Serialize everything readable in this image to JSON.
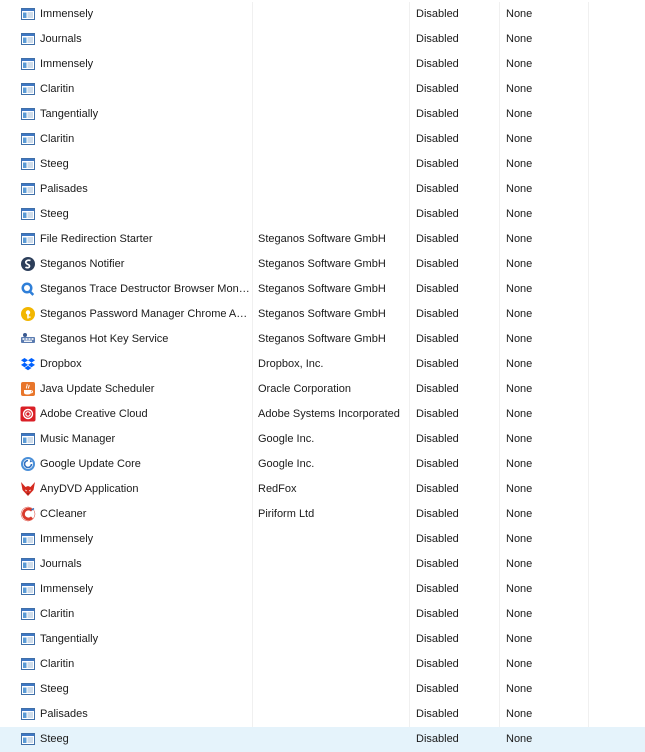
{
  "rows": [
    {
      "icon": "window-icon",
      "name": "Immensely",
      "publisher": "",
      "status": "Disabled",
      "impact": "None"
    },
    {
      "icon": "window-icon",
      "name": "Journals",
      "publisher": "",
      "status": "Disabled",
      "impact": "None"
    },
    {
      "icon": "window-icon",
      "name": "Immensely",
      "publisher": "",
      "status": "Disabled",
      "impact": "None"
    },
    {
      "icon": "window-icon",
      "name": "Claritin",
      "publisher": "",
      "status": "Disabled",
      "impact": "None"
    },
    {
      "icon": "window-icon",
      "name": "Tangentially",
      "publisher": "",
      "status": "Disabled",
      "impact": "None"
    },
    {
      "icon": "window-icon",
      "name": "Claritin",
      "publisher": "",
      "status": "Disabled",
      "impact": "None"
    },
    {
      "icon": "window-icon",
      "name": "Steeg",
      "publisher": "",
      "status": "Disabled",
      "impact": "None"
    },
    {
      "icon": "window-icon",
      "name": "Palisades",
      "publisher": "",
      "status": "Disabled",
      "impact": "None"
    },
    {
      "icon": "window-icon",
      "name": "Steeg",
      "publisher": "",
      "status": "Disabled",
      "impact": "None"
    },
    {
      "icon": "window-icon",
      "name": "File Redirection Starter",
      "publisher": "Steganos Software GmbH",
      "status": "Disabled",
      "impact": "None"
    },
    {
      "icon": "steganos-notifier-icon",
      "name": "Steganos Notifier",
      "publisher": "Steganos Software GmbH",
      "status": "Disabled",
      "impact": "None"
    },
    {
      "icon": "trace-destructor-icon",
      "name": "Steganos Trace Destructor Browser Monitor",
      "publisher": "Steganos Software GmbH",
      "status": "Disabled",
      "impact": "None"
    },
    {
      "icon": "password-manager-icon",
      "name": "Steganos Password Manager Chrome Aut...",
      "publisher": "Steganos Software GmbH",
      "status": "Disabled",
      "impact": "None"
    },
    {
      "icon": "hotkey-service-icon",
      "name": "Steganos Hot Key Service",
      "publisher": "Steganos Software GmbH",
      "status": "Disabled",
      "impact": "None"
    },
    {
      "icon": "dropbox-icon",
      "name": "Dropbox",
      "publisher": "Dropbox, Inc.",
      "status": "Disabled",
      "impact": "None"
    },
    {
      "icon": "java-icon",
      "name": "Java Update Scheduler",
      "publisher": "Oracle Corporation",
      "status": "Disabled",
      "impact": "None"
    },
    {
      "icon": "adobe-cc-icon",
      "name": "Adobe Creative Cloud",
      "publisher": "Adobe Systems Incorporated",
      "status": "Disabled",
      "impact": "None"
    },
    {
      "icon": "window-icon",
      "name": "Music Manager",
      "publisher": "Google Inc.",
      "status": "Disabled",
      "impact": "None"
    },
    {
      "icon": "google-update-icon",
      "name": "Google Update Core",
      "publisher": "Google Inc.",
      "status": "Disabled",
      "impact": "None"
    },
    {
      "icon": "anydvd-fox-icon",
      "name": "AnyDVD Application",
      "publisher": "RedFox",
      "status": "Disabled",
      "impact": "None"
    },
    {
      "icon": "ccleaner-icon",
      "name": "CCleaner",
      "publisher": "Piriform Ltd",
      "status": "Disabled",
      "impact": "None"
    },
    {
      "icon": "window-icon",
      "name": "Immensely",
      "publisher": "",
      "status": "Disabled",
      "impact": "None"
    },
    {
      "icon": "window-icon",
      "name": "Journals",
      "publisher": "",
      "status": "Disabled",
      "impact": "None"
    },
    {
      "icon": "window-icon",
      "name": "Immensely",
      "publisher": "",
      "status": "Disabled",
      "impact": "None"
    },
    {
      "icon": "window-icon",
      "name": "Claritin",
      "publisher": "",
      "status": "Disabled",
      "impact": "None"
    },
    {
      "icon": "window-icon",
      "name": "Tangentially",
      "publisher": "",
      "status": "Disabled",
      "impact": "None"
    },
    {
      "icon": "window-icon",
      "name": "Claritin",
      "publisher": "",
      "status": "Disabled",
      "impact": "None"
    },
    {
      "icon": "window-icon",
      "name": "Steeg",
      "publisher": "",
      "status": "Disabled",
      "impact": "None"
    },
    {
      "icon": "window-icon",
      "name": "Palisades",
      "publisher": "",
      "status": "Disabled",
      "impact": "None"
    },
    {
      "icon": "window-icon",
      "name": "Steeg",
      "publisher": "",
      "status": "Disabled",
      "impact": "None",
      "selected": true
    }
  ],
  "colors": {
    "selected_row": "#e5f3fb",
    "text": "#1a1a1a",
    "separator": "#f0f0f0"
  }
}
